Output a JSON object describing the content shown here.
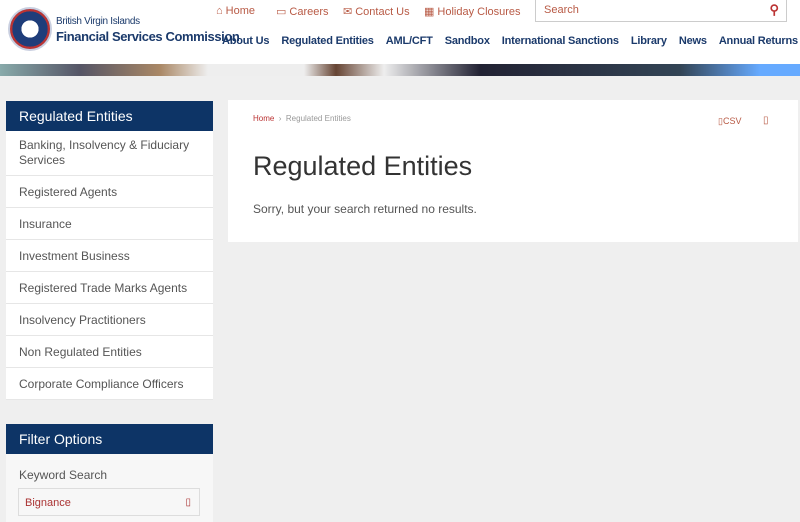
{
  "header": {
    "org_line1": "British Virgin Islands",
    "org_line2": "Financial Services Commission",
    "util_links": [
      {
        "label": "Home",
        "icon": "home-icon",
        "glyph": "⌂"
      },
      {
        "label": "Careers",
        "icon": "folder-icon",
        "glyph": "▭"
      },
      {
        "label": "Contact Us",
        "icon": "envelope-icon",
        "glyph": "✉"
      },
      {
        "label": "Holiday Closures",
        "icon": "calendar-icon",
        "glyph": "▦"
      }
    ],
    "search_placeholder": "Search",
    "nav": [
      "About Us",
      "Regulated Entities",
      "AML/CFT",
      "Sandbox",
      "International Sanctions",
      "Library",
      "News",
      "Annual Returns"
    ]
  },
  "sidebar": {
    "title": "Regulated Entities",
    "items": [
      "Banking, Insolvency & Fiduciary Services",
      "Registered Agents",
      "Insurance",
      "Investment Business",
      "Registered Trade Marks Agents",
      "Insolvency Practitioners",
      "Non Regulated Entities",
      "Corporate Compliance Officers"
    ]
  },
  "filter": {
    "title": "Filter Options",
    "keyword_label": "Keyword Search",
    "keyword_value": "Bignance"
  },
  "main": {
    "breadcrumb": [
      "Home",
      "Regulated Entities"
    ],
    "csv_label": "CSV",
    "title": "Regulated Entities",
    "message": "Sorry, but your search returned no results."
  },
  "colors": {
    "navy": "#0d3466",
    "accent": "#b85a45"
  }
}
